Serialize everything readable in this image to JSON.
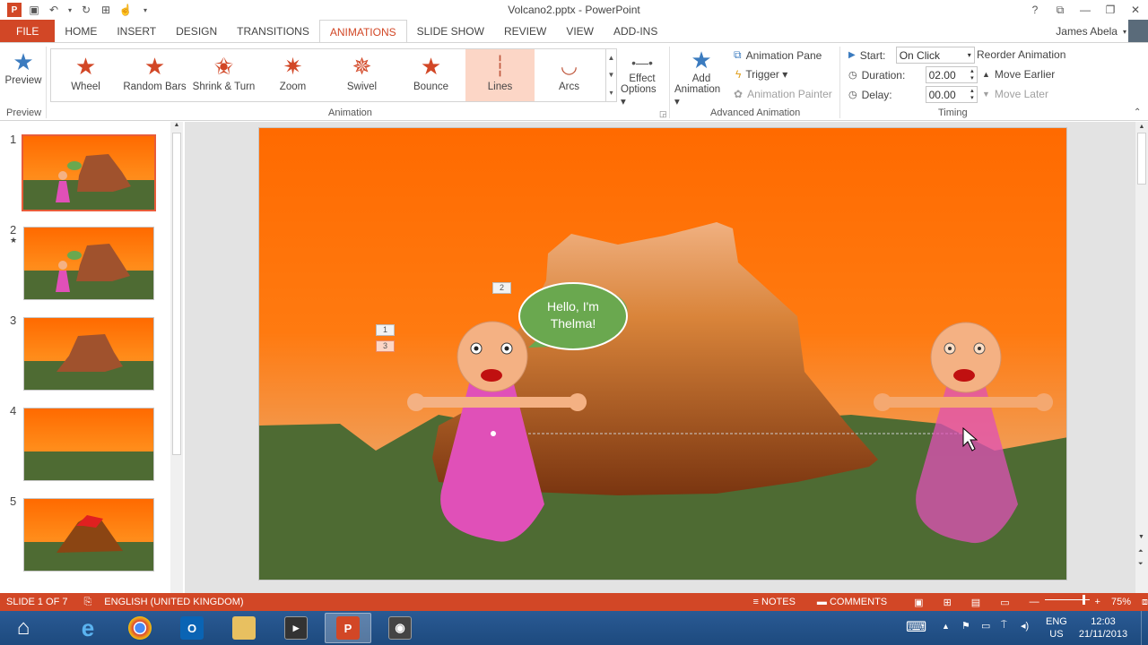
{
  "window": {
    "title": "Volcano2.pptx - PowerPoint",
    "controls": [
      "?",
      "❐",
      "—",
      "❐",
      "✕"
    ]
  },
  "tabs": [
    {
      "label": "FILE"
    },
    {
      "label": "HOME"
    },
    {
      "label": "INSERT"
    },
    {
      "label": "DESIGN"
    },
    {
      "label": "TRANSITIONS"
    },
    {
      "label": "ANIMATIONS"
    },
    {
      "label": "SLIDE SHOW"
    },
    {
      "label": "REVIEW"
    },
    {
      "label": "VIEW"
    },
    {
      "label": "ADD-INS"
    }
  ],
  "user": {
    "name": "James Abela"
  },
  "ribbon": {
    "preview": {
      "label": "Preview",
      "group": "Preview"
    },
    "gallery": [
      {
        "label": "Wheel"
      },
      {
        "label": "Random Bars"
      },
      {
        "label": "Shrink & Turn"
      },
      {
        "label": "Zoom"
      },
      {
        "label": "Swivel"
      },
      {
        "label": "Bounce"
      },
      {
        "label": "Lines"
      },
      {
        "label": "Arcs"
      }
    ],
    "effect_options": {
      "line1": "Effect",
      "line2": "Options ▾"
    },
    "animation_group": "Animation",
    "add_animation": {
      "line1": "Add",
      "line2": "Animation ▾"
    },
    "animation_pane": "Animation Pane",
    "trigger": "Trigger ▾",
    "animation_painter": "Animation Painter",
    "advanced_group": "Advanced Animation",
    "start_label": "Start:",
    "start_value": "On Click",
    "duration_label": "Duration:",
    "duration_value": "02.00",
    "delay_label": "Delay:",
    "delay_value": "00.00",
    "reorder": "Reorder Animation",
    "move_earlier": "Move Earlier",
    "move_later": "Move Later",
    "timing_group": "Timing"
  },
  "slides": [
    {
      "number": "1",
      "star": ""
    },
    {
      "number": "2",
      "star": "★"
    },
    {
      "number": "3",
      "star": ""
    },
    {
      "number": "4",
      "star": ""
    },
    {
      "number": "5",
      "star": ""
    }
  ],
  "slide_content": {
    "speech_line1": "Hello, I'm",
    "speech_line2": "Thelma!",
    "anim_tags": [
      "1",
      "2",
      "3"
    ]
  },
  "status": {
    "slide_of": "SLIDE 1 OF 7",
    "language": "ENGLISH (UNITED KINGDOM)",
    "notes": "NOTES",
    "comments": "COMMENTS",
    "zoom": "75%"
  },
  "taskbar": {
    "lang1": "ENG",
    "lang2": "US",
    "time": "12:03",
    "date": "21/11/2013"
  },
  "colors": {
    "accent": "#d24726",
    "sky_top": "#ff6a00",
    "grass": "#4e6b33",
    "character": "#e050b8",
    "bubble": "#6aa84f"
  }
}
